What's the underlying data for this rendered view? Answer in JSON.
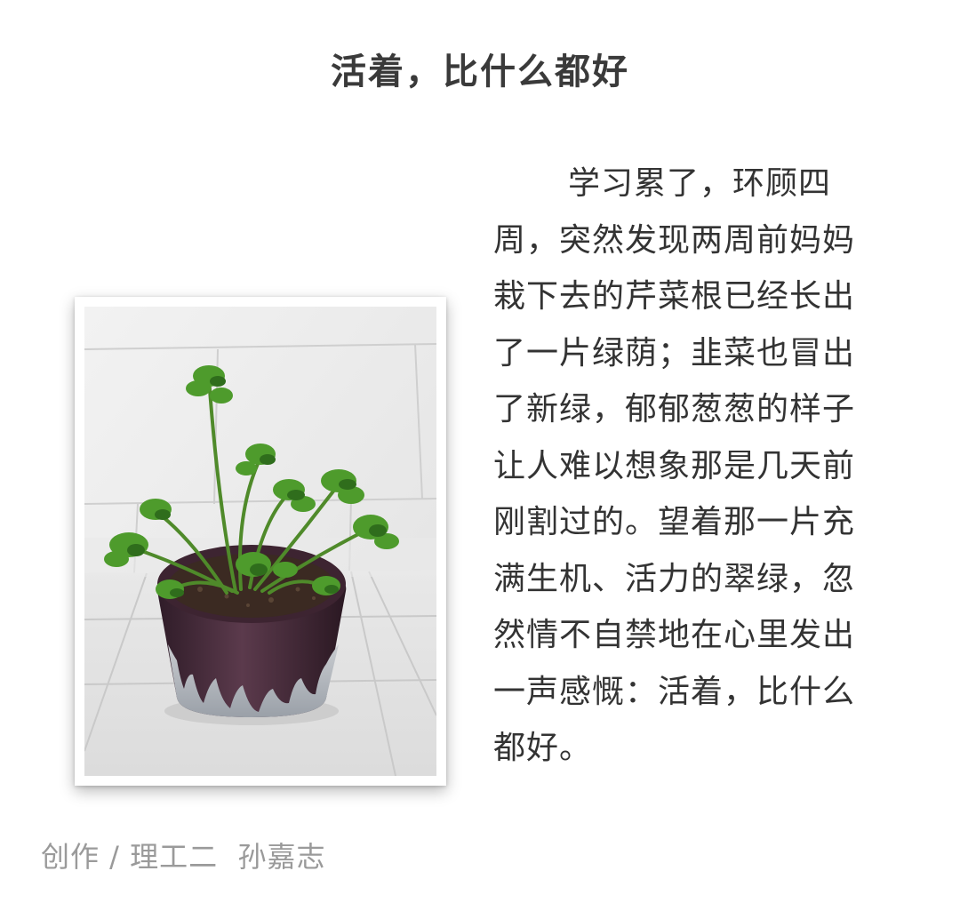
{
  "article": {
    "title": "活着，比什么都好",
    "body": "学习累了，环顾四周，突然发现两周前妈妈栽下去的芹菜根已经长出了一片绿荫；韭菜也冒出了新绿，郁郁葱葱的样子让人难以想象那是几天前刚割过的。望着那一片充满生机、活力的翠绿，忽然情不自禁地在心里发出一声感慨：活着，比什么都好。",
    "credit": "创作 / 理工二  孙嘉志"
  },
  "photo": {
    "subject": "potted-celery-plant",
    "colors": {
      "leaf": "#4f9a2e",
      "leaf_dark": "#2f6d1c",
      "pot": "#4a2b3c",
      "wall_tile": "#ebebeb",
      "floor_tile": "#e6e6e6"
    }
  }
}
